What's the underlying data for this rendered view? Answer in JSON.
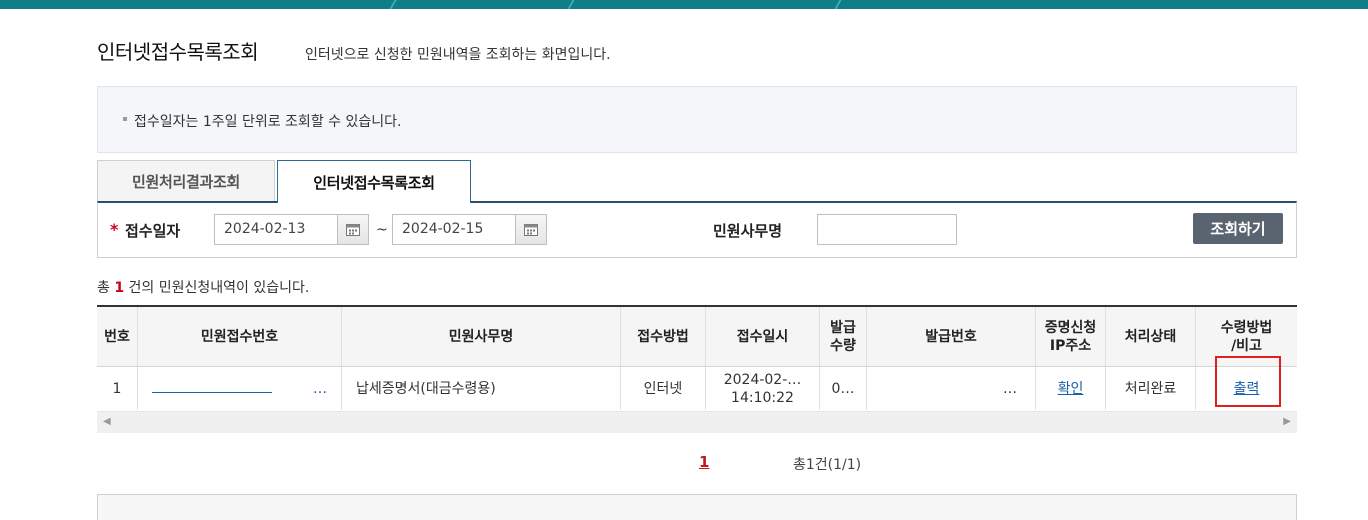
{
  "header": {
    "title": "인터넷접수목록조회",
    "description": "인터넷으로 신청한 민원내역을 조회하는 화면입니다."
  },
  "notice": {
    "text": "접수일자는 1주일 단위로 조회할 수 있습니다."
  },
  "tabs": [
    {
      "label": "민원처리결과조회",
      "active": false
    },
    {
      "label": "인터넷접수목록조회",
      "active": true
    }
  ],
  "search": {
    "date_label": "접수일자",
    "required_mark": "*",
    "start_date": "2024-02-13",
    "end_date": "2024-02-15",
    "range_separator": "~",
    "office_label": "민원사무명",
    "office_value": "",
    "button_label": "조회하기"
  },
  "summary": {
    "prefix": "총",
    "count": "1",
    "suffix": "건의 민원신청내역이 있습니다."
  },
  "table": {
    "headers": [
      "번호",
      "민원접수번호",
      "민원사무명",
      "접수방법",
      "접수일시",
      "발급\n수량",
      "발급번호",
      "증명신청\nIP주소",
      "처리상태",
      "수령방법\n/비고"
    ],
    "rows": [
      {
        "no": "1",
        "receipt_no": "…",
        "office": "납세증명서(대금수령용)",
        "method": "인터넷",
        "date_line1": "2024-02-…",
        "date_line2": "14:10:22",
        "qty": "0…",
        "issue_no": "…",
        "ip": "확인",
        "status": "처리완료",
        "remark": "출력"
      }
    ]
  },
  "pager": {
    "current": "1",
    "total": "총1건(1/1)"
  },
  "colors": {
    "topbar": "#0e7f88",
    "accent_red": "#d0021b",
    "button": "#5a6470",
    "link": "#1a5fa8"
  }
}
